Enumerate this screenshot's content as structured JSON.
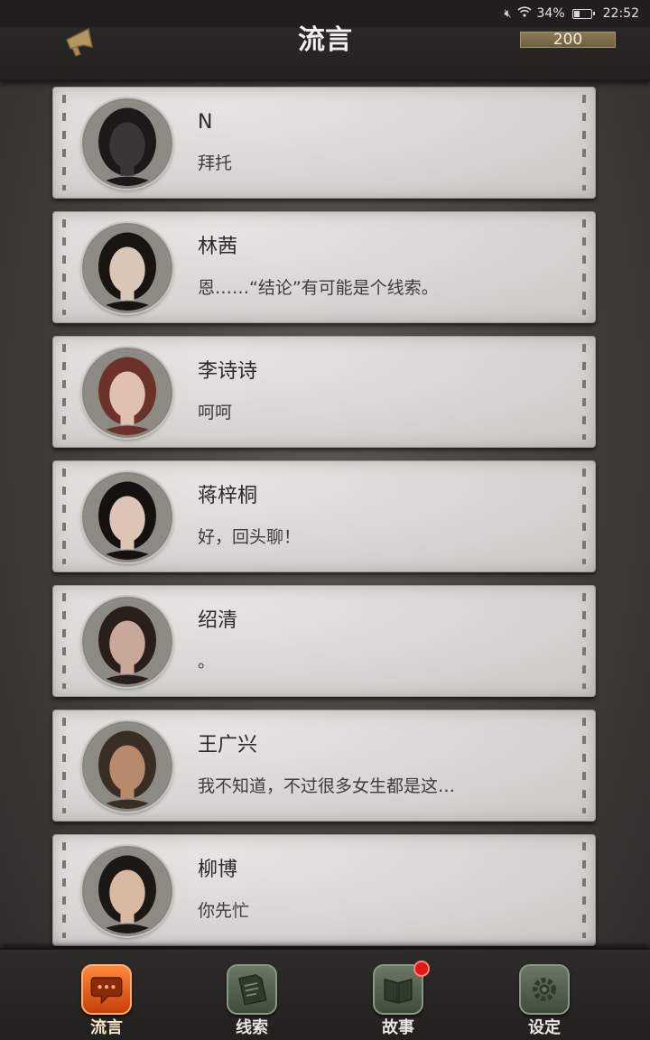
{
  "status_bar": {
    "battery_text": "34%",
    "battery_level": 0.34,
    "time": "22:52",
    "icons": [
      "mute-icon",
      "wifi-icon",
      "battery-icon"
    ]
  },
  "header": {
    "title": "流言",
    "coins": "200",
    "megaphone_icon": "megaphone-icon"
  },
  "contacts": [
    {
      "name": "N",
      "message": "拜托",
      "avatar_colors": [
        "#3a3634",
        "#1b1a19"
      ]
    },
    {
      "name": "林茜",
      "message": "恩……“结论”有可能是个线索。",
      "avatar_colors": [
        "#d8c6b8",
        "#1a1410"
      ]
    },
    {
      "name": "李诗诗",
      "message": "呵呵",
      "avatar_colors": [
        "#e2c0b0",
        "#6a3228"
      ]
    },
    {
      "name": "蒋梓桐",
      "message": "好，回头聊！",
      "avatar_colors": [
        "#dcc4b6",
        "#15110f"
      ]
    },
    {
      "name": "绍清",
      "message": "。",
      "avatar_colors": [
        "#c8a89a",
        "#2a1e1a"
      ]
    },
    {
      "name": "王广兴",
      "message": "我不知道，不过很多女生都是这…",
      "avatar_colors": [
        "#b68a6a",
        "#3a2e24"
      ]
    },
    {
      "name": "柳博",
      "message": "你先忙",
      "avatar_colors": [
        "#d8b8a0",
        "#1c1816"
      ]
    }
  ],
  "nav": [
    {
      "label": "流言",
      "icon": "chat-bubble-icon",
      "active": true,
      "badge": false
    },
    {
      "label": "线索",
      "icon": "document-icon",
      "active": false,
      "badge": false
    },
    {
      "label": "故事",
      "icon": "book-icon",
      "active": false,
      "badge": true
    },
    {
      "label": "设定",
      "icon": "gear-icon",
      "active": false,
      "badge": false
    }
  ],
  "colors": {
    "active_nav": "#e0601c",
    "badge": "#e01818",
    "card": "#d6d4d0"
  }
}
